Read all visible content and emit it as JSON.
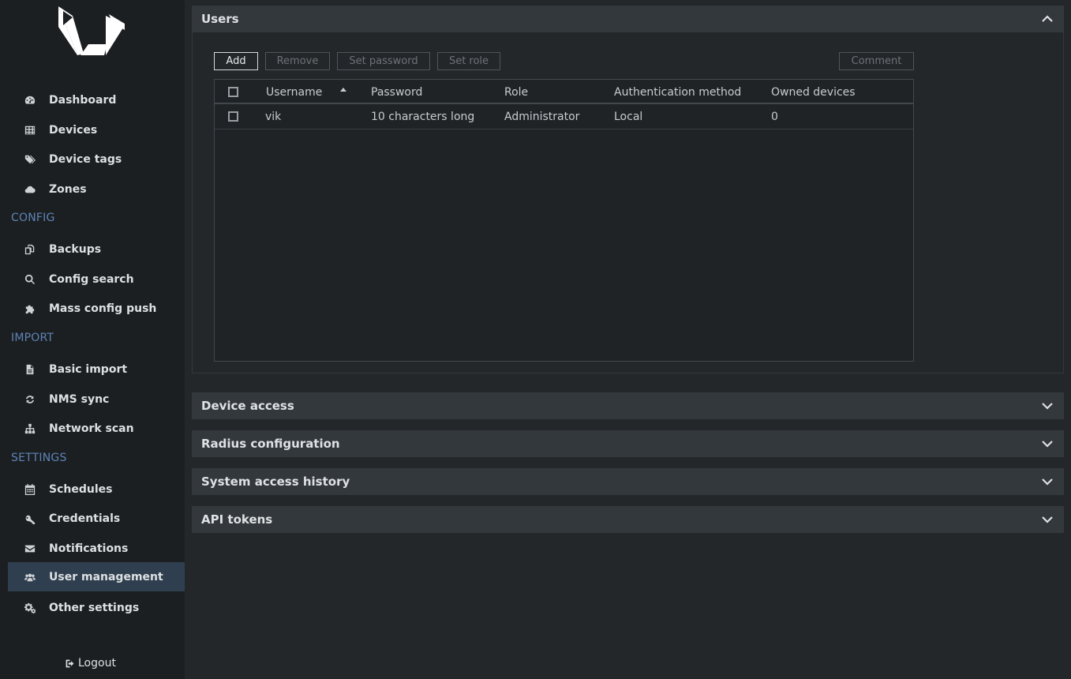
{
  "sidebar": {
    "main_items": [
      {
        "label": "Dashboard",
        "icon": "dashboard-icon"
      },
      {
        "label": "Devices",
        "icon": "table-icon"
      },
      {
        "label": "Device tags",
        "icon": "tags-icon"
      },
      {
        "label": "Zones",
        "icon": "cloud-icon"
      }
    ],
    "config_label": "CONFIG",
    "config_items": [
      {
        "label": "Backups",
        "icon": "copy-icon"
      },
      {
        "label": "Config search",
        "icon": "search-icon"
      },
      {
        "label": "Mass config push",
        "icon": "puzzle-icon"
      }
    ],
    "import_label": "IMPORT",
    "import_items": [
      {
        "label": "Basic import",
        "icon": "file-icon"
      },
      {
        "label": "NMS sync",
        "icon": "refresh-icon"
      },
      {
        "label": "Network scan",
        "icon": "sitemap-icon"
      }
    ],
    "settings_label": "SETTINGS",
    "settings_items": [
      {
        "label": "Schedules",
        "icon": "calendar-icon"
      },
      {
        "label": "Credentials",
        "icon": "key-icon"
      },
      {
        "label": "Notifications",
        "icon": "envelope-icon"
      },
      {
        "label": "User management",
        "icon": "users-icon",
        "active": true
      },
      {
        "label": "Other settings",
        "icon": "gears-icon"
      }
    ],
    "logout_label": "Logout"
  },
  "users_panel": {
    "title": "Users",
    "buttons": {
      "add": "Add",
      "remove": "Remove",
      "set_password": "Set password",
      "set_role": "Set role",
      "comment": "Comment"
    },
    "columns": [
      "Username",
      "Password",
      "Role",
      "Authentication method",
      "Owned devices"
    ],
    "rows": [
      {
        "username": "vik",
        "password": "10 characters long",
        "role": "Administrator",
        "auth": "Local",
        "owned": "0"
      }
    ]
  },
  "collapsed_panels": [
    "Device access",
    "Radius configuration",
    "System access history",
    "API tokens"
  ],
  "colors": {
    "background": "#23272a",
    "sidebar": "#1b1f22",
    "panel_header": "#33383c",
    "section_label": "#5f83b5",
    "active_item": "#2f3f4f"
  }
}
